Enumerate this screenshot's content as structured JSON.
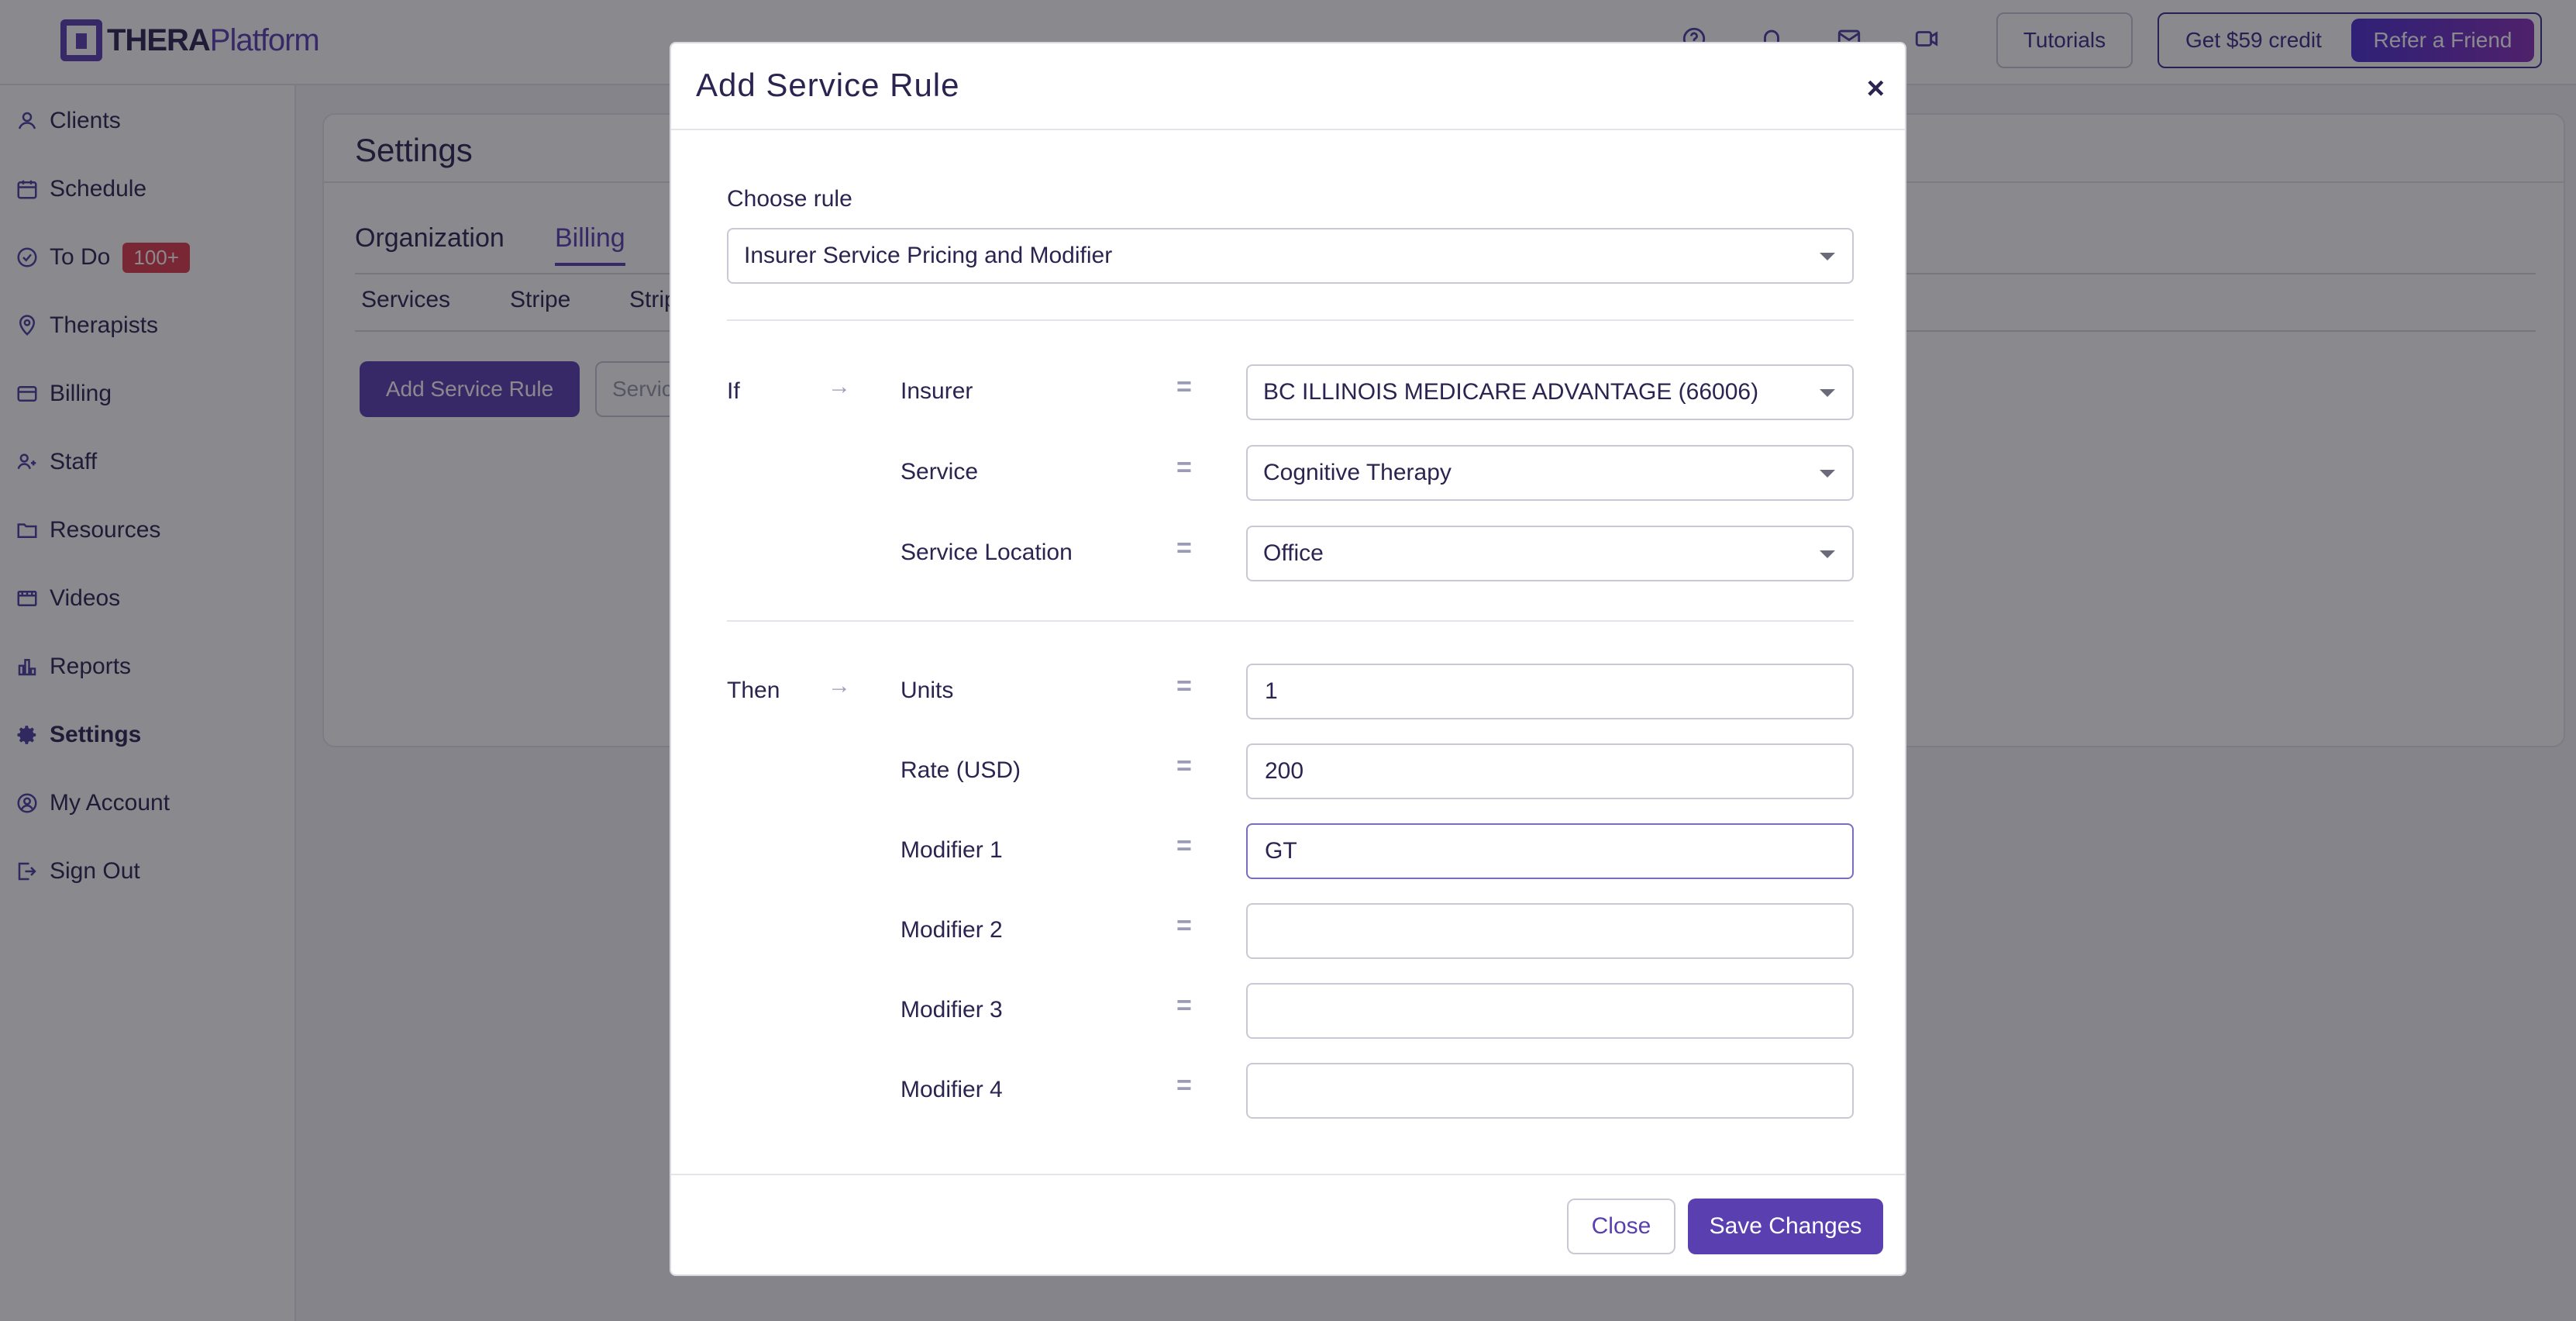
{
  "app": {
    "logo_bold": "THERA",
    "logo_light": "Platform"
  },
  "topbar": {
    "tutorials_label": "Tutorials",
    "credit_label": "Get $59 credit",
    "refer_label": "Refer a Friend",
    "icons": [
      "help-icon",
      "bell-icon",
      "mail-icon",
      "video-icon"
    ]
  },
  "sidebar": {
    "items": [
      {
        "label": "Clients",
        "icon": "user-icon"
      },
      {
        "label": "Schedule",
        "icon": "calendar-icon"
      },
      {
        "label": "To Do",
        "icon": "check-circle-icon",
        "badge": "100+"
      },
      {
        "label": "Therapists",
        "icon": "location-icon"
      },
      {
        "label": "Billing",
        "icon": "card-icon"
      },
      {
        "label": "Staff",
        "icon": "staff-icon"
      },
      {
        "label": "Resources",
        "icon": "folder-icon"
      },
      {
        "label": "Videos",
        "icon": "film-icon"
      },
      {
        "label": "Reports",
        "icon": "bar-chart-icon"
      },
      {
        "label": "Settings",
        "icon": "gear-icon"
      },
      {
        "label": "My Account",
        "icon": "account-icon"
      },
      {
        "label": "Sign Out",
        "icon": "sign-out-icon"
      }
    ]
  },
  "settings": {
    "title": "Settings",
    "tabs": [
      "Organization",
      "Billing"
    ],
    "active_tab": "Billing",
    "subtabs": [
      "Services",
      "Stripe",
      "Strip"
    ],
    "add_rule_label": "Add Service Rule",
    "filter_placeholder": "Servic"
  },
  "modal": {
    "title": "Add Service Rule",
    "close_glyph": "×",
    "choose_rule_label": "Choose rule",
    "rule_value": "Insurer Service Pricing and Modifier",
    "if_label": "If",
    "then_label": "Then",
    "arrow": "→",
    "equals": "=",
    "conditions": [
      {
        "label": "Insurer",
        "value": "BC ILLINOIS MEDICARE ADVANTAGE (66006)"
      },
      {
        "label": "Service",
        "value": "Cognitive Therapy"
      },
      {
        "label": "Service Location",
        "value": "Office"
      }
    ],
    "actions": [
      {
        "label": "Units",
        "value": "1"
      },
      {
        "label": "Rate (USD)",
        "value": "200"
      },
      {
        "label": "Modifier 1",
        "value": "GT"
      },
      {
        "label": "Modifier 2",
        "value": ""
      },
      {
        "label": "Modifier 3",
        "value": ""
      },
      {
        "label": "Modifier 4",
        "value": ""
      }
    ],
    "close_label": "Close",
    "save_label": "Save Changes"
  }
}
